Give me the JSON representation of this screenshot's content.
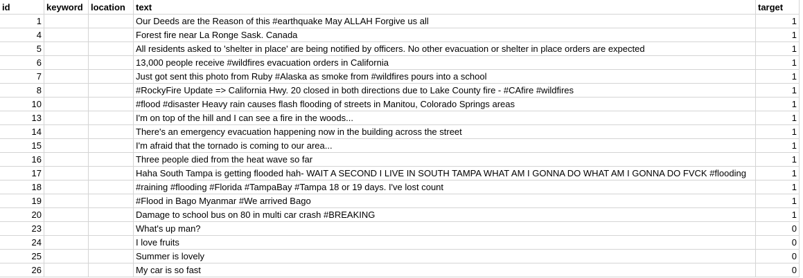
{
  "headers": {
    "id": "id",
    "keyword": "keyword",
    "location": "location",
    "text": "text",
    "target": "target"
  },
  "rows": [
    {
      "id": "1",
      "keyword": "",
      "location": "",
      "text": "Our Deeds are the Reason of this #earthquake May ALLAH Forgive us all",
      "target": "1"
    },
    {
      "id": "4",
      "keyword": "",
      "location": "",
      "text": "Forest fire near La Ronge Sask. Canada",
      "target": "1"
    },
    {
      "id": "5",
      "keyword": "",
      "location": "",
      "text": "All residents asked to 'shelter in place' are being notified by officers. No other evacuation or shelter in place orders are expected",
      "target": "1"
    },
    {
      "id": "6",
      "keyword": "",
      "location": "",
      "text": "13,000 people receive #wildfires evacuation orders in California",
      "target": "1"
    },
    {
      "id": "7",
      "keyword": "",
      "location": "",
      "text": "Just got sent this photo from Ruby #Alaska as smoke from #wildfires pours into a school",
      "target": "1"
    },
    {
      "id": "8",
      "keyword": "",
      "location": "",
      "text": "#RockyFire Update => California Hwy. 20 closed in both directions due to Lake County fire - #CAfire #wildfires",
      "target": "1"
    },
    {
      "id": "10",
      "keyword": "",
      "location": "",
      "text": "#flood #disaster Heavy rain causes flash flooding of streets in Manitou, Colorado Springs areas",
      "target": "1"
    },
    {
      "id": "13",
      "keyword": "",
      "location": "",
      "text": "I'm on top of the hill and I can see a fire in the woods...",
      "target": "1"
    },
    {
      "id": "14",
      "keyword": "",
      "location": "",
      "text": "There's an emergency evacuation happening now in the building across the street",
      "target": "1"
    },
    {
      "id": "15",
      "keyword": "",
      "location": "",
      "text": "I'm afraid that the tornado is coming to our area...",
      "target": "1"
    },
    {
      "id": "16",
      "keyword": "",
      "location": "",
      "text": "Three people died from the heat wave so far",
      "target": "1"
    },
    {
      "id": "17",
      "keyword": "",
      "location": "",
      "text": "Haha South Tampa is getting flooded hah- WAIT A SECOND I LIVE IN SOUTH TAMPA WHAT AM I GONNA DO WHAT AM I GONNA DO FVCK #flooding",
      "target": "1"
    },
    {
      "id": "18",
      "keyword": "",
      "location": "",
      "text": "#raining #flooding #Florida #TampaBay #Tampa 18 or 19 days. I've lost count",
      "target": "1"
    },
    {
      "id": "19",
      "keyword": "",
      "location": "",
      "text": "#Flood in Bago Myanmar #We arrived Bago",
      "target": "1"
    },
    {
      "id": "20",
      "keyword": "",
      "location": "",
      "text": "Damage to school bus on 80 in multi car crash #BREAKING",
      "target": "1"
    },
    {
      "id": "23",
      "keyword": "",
      "location": "",
      "text": "What's up man?",
      "target": "0"
    },
    {
      "id": "24",
      "keyword": "",
      "location": "",
      "text": "I love fruits",
      "target": "0"
    },
    {
      "id": "25",
      "keyword": "",
      "location": "",
      "text": "Summer is lovely",
      "target": "0"
    },
    {
      "id": "26",
      "keyword": "",
      "location": "",
      "text": "My car is so fast",
      "target": "0"
    }
  ]
}
